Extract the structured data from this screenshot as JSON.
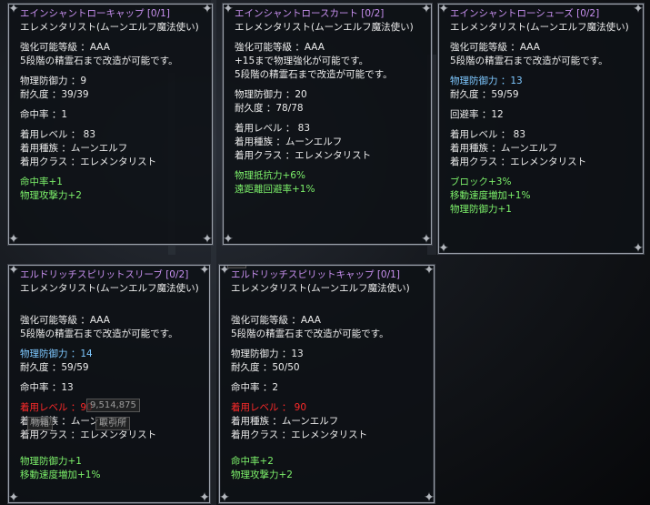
{
  "tooltips": [
    {
      "title": "エインシャントローキャップ [0/1]",
      "class_line": "エレメンタリスト(ムーンエルフ魔法使い)",
      "enhance": "強化可能等級 ：AAA",
      "refine": "5段階の精霊石まで改造が可能です。",
      "stat1": "物理防御力 ：9",
      "durability": "耐久度 ：39/39",
      "stat2": "命中率 ：1",
      "req_level": "着用レベル ： 83",
      "req_race": "着用種族 ：ムーンエルフ",
      "req_class": "着用クラス ：エレメンタリスト",
      "bonus1": "命中率+1",
      "bonus2": "物理攻撃力+2",
      "bonus3": ""
    },
    {
      "title": "エインシャントロースカート [0/2]",
      "class_line": "エレメンタリスト(ムーンエルフ魔法使い)",
      "enhance": "強化可能等級 ：AAA",
      "enhance_note": "+15まで物理強化が可能です。",
      "refine": "5段階の精霊石まで改造が可能です。",
      "stat1": "物理防御力 ：20",
      "durability": "耐久度 ：78/78",
      "req_level": "着用レベル ： 83",
      "req_race": "着用種族 ：ムーンエルフ",
      "req_class": "着用クラス ：エレメンタリスト",
      "bonus1": "物理抵抗力+6%",
      "bonus2": "遠距離回避率+1%"
    },
    {
      "title": "エインシャントローシューズ [0/2]",
      "class_line": "エレメンタリスト(ムーンエルフ魔法使い)",
      "enhance": "強化可能等級 ：AAA",
      "refine": "5段階の精霊石まで改造が可能です。",
      "stat1": "物理防御力 ：13",
      "durability": "耐久度 ：59/59",
      "stat2": "回避率 ：12",
      "req_level": "着用レベル ： 83",
      "req_race": "着用種族 ：ムーンエルフ",
      "req_class": "着用クラス ：エレメンタリスト",
      "bonus1": "ブロック+3%",
      "bonus2": "移動速度増加+1%",
      "bonus3": "物理防御力+1"
    },
    {
      "title": "エルドリッチスピリットスリーブ [0/2]",
      "class_line": "エレメンタリスト(ムーンエルフ魔法使い)",
      "enhance": "強化可能等級 ：AAA",
      "refine": "5段階の精霊石まで改造が可能です。",
      "stat1": "物理防御力 ：14",
      "durability": "耐久度 ：59/59",
      "stat2": "命中率 ：13",
      "req_level": "着用レベル ：90",
      "req_race": "着用種族 ：ムーンエルフ",
      "req_class": "着用クラス ：エレメンタリスト",
      "bonus1": "物理防御力+1",
      "bonus2": "移動速度増加+1%",
      "overlay_money": "9,514,875",
      "overlay_btn1": "物箱",
      "overlay_btn2": "取引所"
    },
    {
      "title": "エルドリッチスピリットキャップ [0/1]",
      "class_line": "エレメンタリスト(ムーンエルフ魔法使い)",
      "enhance": "強化可能等級 ：AAA",
      "refine": "5段階の精霊石まで改造が可能です。",
      "stat1": "物理防御力 ：13",
      "durability": "耐久度 ：50/50",
      "stat2": "命中率 ：2",
      "req_level": "着用レベル ： 90",
      "req_race": "着用種族 ：ムーンエルフ",
      "req_class": "着用クラス ：エレメンタリスト",
      "bonus1": "命中率+2",
      "bonus2": "物理攻撃力+2",
      "overlay_top": "55"
    }
  ],
  "corner_icon": "ornament-corner-icon",
  "colors": {
    "title": "#c890f0",
    "blue_stat": "#7ec8ff",
    "bonus": "#7cf06a",
    "requirement_unmet": "#ff2a2a"
  }
}
